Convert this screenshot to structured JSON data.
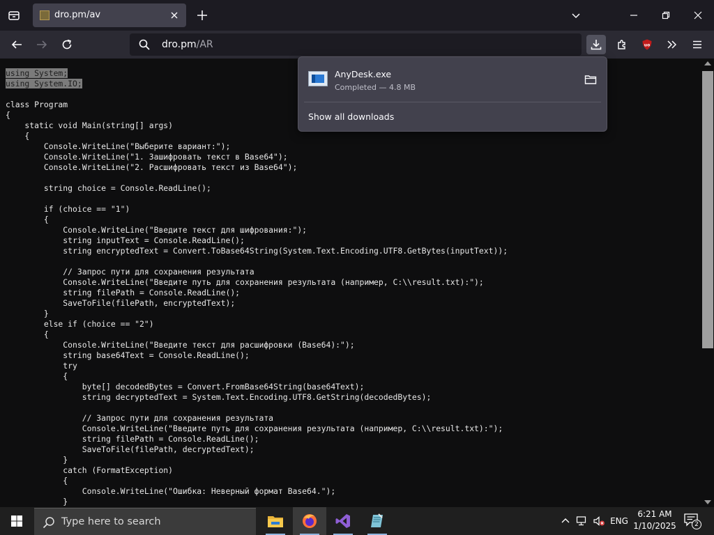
{
  "tab": {
    "title": "dro.pm/av"
  },
  "urlbar": {
    "host": "dro.pm",
    "path": "/AR"
  },
  "downloads": {
    "items": [
      {
        "name": "AnyDesk.exe",
        "status": "Completed — 4.8 MB"
      }
    ],
    "show_all_label": "Show all downloads"
  },
  "code": {
    "lines": [
      "using System;",
      "using System.IO;",
      "",
      "class Program",
      "{",
      "    static void Main(string[] args)",
      "    {",
      "        Console.WriteLine(\"Выберите вариант:\");",
      "        Console.WriteLine(\"1. Зашифровать текст в Base64\");",
      "        Console.WriteLine(\"2. Расшифровать текст из Base64\");",
      "",
      "        string choice = Console.ReadLine();",
      "",
      "        if (choice == \"1\")",
      "        {",
      "            Console.WriteLine(\"Введите текст для шифрования:\");",
      "            string inputText = Console.ReadLine();",
      "            string encryptedText = Convert.ToBase64String(System.Text.Encoding.UTF8.GetBytes(inputText));",
      "",
      "            // Запрос пути для сохранения результата",
      "            Console.WriteLine(\"Введите путь для сохранения результата (например, C:\\\\result.txt):\");",
      "            string filePath = Console.ReadLine();",
      "            SaveToFile(filePath, encryptedText);",
      "        }",
      "        else if (choice == \"2\")",
      "        {",
      "            Console.WriteLine(\"Введите текст для расшифровки (Base64):\");",
      "            string base64Text = Console.ReadLine();",
      "            try",
      "            {",
      "                byte[] decodedBytes = Convert.FromBase64String(base64Text);",
      "                string decryptedText = System.Text.Encoding.UTF8.GetString(decodedBytes);",
      "",
      "                // Запрос пути для сохранения результата",
      "                Console.WriteLine(\"Введите путь для сохранения результата (например, C:\\\\result.txt):\");",
      "                string filePath = Console.ReadLine();",
      "                SaveToFile(filePath, decryptedText);",
      "            }",
      "            catch (FormatException)",
      "            {",
      "                Console.WriteLine(\"Ошибка: Неверный формат Base64.\");",
      "            }"
    ],
    "selected_line_count": 2
  },
  "taskbar": {
    "search_placeholder": "Type here to search",
    "apps": [
      "file-explorer",
      "firefox",
      "visual-studio",
      "notepad"
    ],
    "language": "ENG",
    "time": "6:21 AM",
    "date": "1/10/2025",
    "notification_count": "2"
  },
  "colors": {
    "tabbar_bg": "#1c1b22",
    "toolbar_bg": "#2b2a33",
    "panel_bg": "#42414d",
    "selection_bg": "#7b7b7b",
    "taskbar_bg": "#1f1f1f"
  }
}
